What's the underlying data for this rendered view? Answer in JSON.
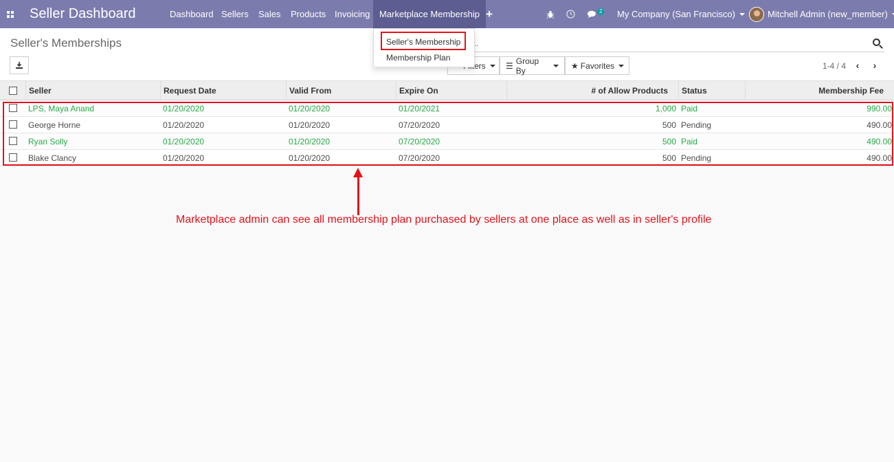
{
  "navbar": {
    "brand": "Seller Dashboard",
    "menus": [
      "Dashboard",
      "Sellers",
      "Sales",
      "Products",
      "Invoicing",
      "Marketplace Membership"
    ],
    "plus": "+",
    "chat_count": "2",
    "company": "My Company (San Francisco)",
    "user": "Mitchell Admin (new_member)"
  },
  "dropdown": {
    "items": [
      "Seller's Membership",
      "Membership Plan"
    ]
  },
  "control_panel": {
    "breadcrumb": "Seller's Memberships",
    "search_placeholder": "....",
    "filters_label": "Filters",
    "groupby_label": "Group By",
    "favorites_label": "Favorites",
    "pager": "1-4 / 4"
  },
  "table": {
    "headers": [
      "Seller",
      "Request Date",
      "Valid From",
      "Expire On",
      "# of Allow Products",
      "Status",
      "Membership Fee"
    ],
    "rows": [
      {
        "seller": "LPS, Maya Anand",
        "request_date": "01/20/2020",
        "valid_from": "01/20/2020",
        "expire_on": "01/20/2021",
        "allow_products": "1,000",
        "status": "Paid",
        "fee": "990.00"
      },
      {
        "seller": "George Horne",
        "request_date": "01/20/2020",
        "valid_from": "01/20/2020",
        "expire_on": "07/20/2020",
        "allow_products": "500",
        "status": "Pending",
        "fee": "490.00"
      },
      {
        "seller": "Ryan Solly",
        "request_date": "01/20/2020",
        "valid_from": "01/20/2020",
        "expire_on": "07/20/2020",
        "allow_products": "500",
        "status": "Paid",
        "fee": "490.00"
      },
      {
        "seller": "Blake Clancy",
        "request_date": "01/20/2020",
        "valid_from": "01/20/2020",
        "expire_on": "07/20/2020",
        "allow_products": "500",
        "status": "Pending",
        "fee": "490.00"
      }
    ]
  },
  "annotation": "Marketplace admin can see all membership plan purchased by sellers at one place as well as in seller's profile",
  "colors": {
    "navbar": "#7c7bad",
    "active_menu": "#5e5d91",
    "paid_row": "#28a745",
    "highlight": "#e3121b"
  }
}
